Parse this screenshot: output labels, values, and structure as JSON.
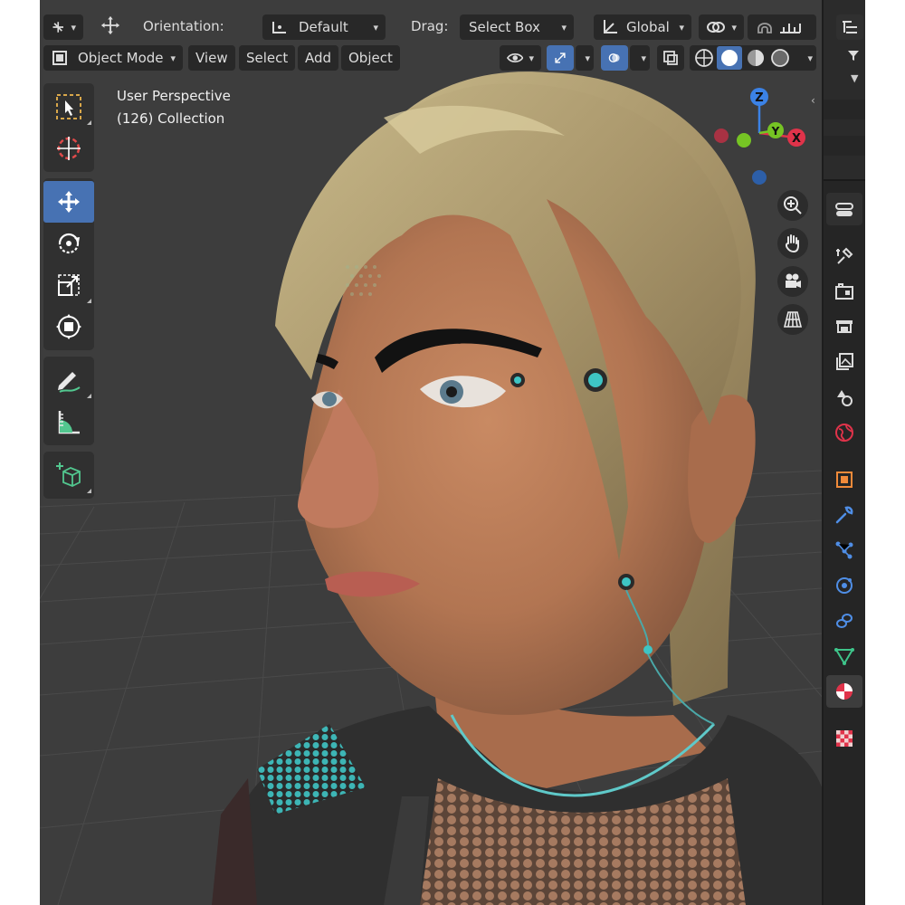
{
  "header": {
    "transform_pivot_icon": "transform-pivot-icon",
    "move_icon": "move-arrows-icon",
    "orientation_label": "Orientation:",
    "orientation_value": "Default",
    "drag_label": "Drag:",
    "drag_value": "Select Box",
    "transform_space_value": "Global",
    "mode_value": "Object Mode",
    "menu": [
      "View",
      "Select",
      "Add",
      "Object"
    ]
  },
  "viewport": {
    "perspective_label": "User Perspective",
    "collection_label": "(126) Collection",
    "gizmo_axes": {
      "z": "Z",
      "y": "Y",
      "x": "X"
    }
  },
  "toolbar": {
    "tools": [
      "select-box",
      "cursor",
      "move",
      "rotate",
      "scale",
      "transform",
      "annotate",
      "measure",
      "add-cube"
    ],
    "active_tool": "move"
  },
  "properties_tabs": [
    "tool",
    "render",
    "output",
    "view-layer",
    "scene",
    "world",
    "object",
    "modifiers",
    "particles",
    "physics",
    "constraints",
    "object-data",
    "material",
    "texture"
  ],
  "active_properties_tab": "material",
  "colors": {
    "accent": "#4772b3",
    "axis_x": "#e0334a",
    "axis_y": "#76c424",
    "axis_z": "#3b82e6",
    "panel": "#303030",
    "viewport": "#3d3d3d"
  }
}
